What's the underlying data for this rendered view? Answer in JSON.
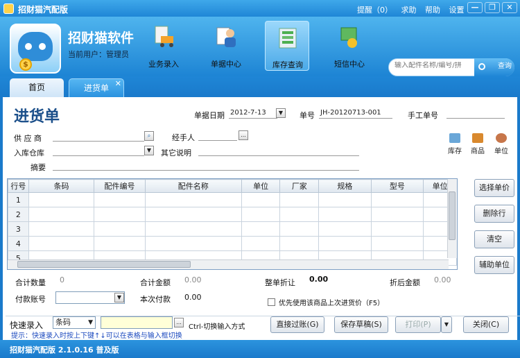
{
  "window": {
    "title": "招财猫汽配版",
    "links": [
      "提醒（0）",
      "求助",
      "帮助",
      "设置"
    ],
    "min": "—",
    "max": "❐",
    "close": "✕"
  },
  "header": {
    "brand": "招财猫软件",
    "user": "当前用户：管理员",
    "modules": [
      {
        "label": "业务录入",
        "icon": "cart-icon"
      },
      {
        "label": "单据中心",
        "icon": "document-user-icon"
      },
      {
        "label": "库存查询",
        "icon": "warehouse-icon",
        "active": true
      },
      {
        "label": "短信中心",
        "icon": "message-icon"
      }
    ],
    "search": {
      "placeholder": "输入配件名称/编号/拼",
      "button": "查询"
    }
  },
  "tabs": [
    {
      "label": "首页"
    },
    {
      "label": "进货单",
      "active": true,
      "close": "✕"
    }
  ],
  "form": {
    "title": "进货单",
    "date_label": "单据日期",
    "date_value": "2012-7-13",
    "no_label": "单号",
    "no_value": "JH-20120713-001",
    "manual_label": "手工单号",
    "supplier_label": "供 应 商",
    "handler_label": "经手人",
    "warehouse_label": "入库仓库",
    "other_label": "其它说明",
    "summary_label": "摘要",
    "ellipsis": "...",
    "shortcuts": [
      "库存",
      "商品",
      "单位"
    ]
  },
  "grid": {
    "columns": [
      "行号",
      "条码",
      "配件编号",
      "配件名称",
      "单位",
      "厂家",
      "规格",
      "型号",
      "单位"
    ],
    "rows": [
      "1",
      "2",
      "3",
      "4",
      "5"
    ]
  },
  "side_buttons": [
    "选择单价",
    "删除行",
    "清空",
    "辅助单位"
  ],
  "totals": {
    "qty_label": "合计数量",
    "qty_value": "0",
    "amount_label": "合计金额",
    "amount_value": "0.00",
    "discount_label": "整单折让",
    "discount_value": "0.00",
    "after_label": "折后金额",
    "after_value": "0.00",
    "account_label": "付款账号",
    "pay_label": "本次付款",
    "pay_value": "0.00",
    "prefer_label": "优先使用该商品上次进货价（F5）"
  },
  "quick": {
    "label": "快速录入",
    "mode": "条码",
    "switch_hint": "Ctrl-切换输入方式",
    "buttons": [
      "直接过账(G)",
      "保存草稿(S)",
      "打印(P)",
      "关闭(C)"
    ],
    "tip": "提示：快速录入时按上下键↑↓可以在表格与输入框切换"
  },
  "status": "招财猫汽配版 2.1.0.16 普及版"
}
